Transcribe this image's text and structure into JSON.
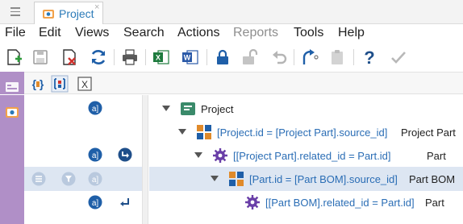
{
  "tab": {
    "label": "Project",
    "close": "×"
  },
  "menu": [
    "File",
    "Edit",
    "Views",
    "Search",
    "Actions",
    "Reports",
    "Tools",
    "Help"
  ],
  "menu_disabled": [
    "Reports"
  ],
  "toolbar": {
    "icons": [
      "new-icon",
      "save-icon",
      "delete-icon",
      "refresh-icon",
      "print-icon",
      "excel-icon",
      "word-icon",
      "lock-icon",
      "unlock-icon",
      "undo-icon",
      "promote-icon",
      "paste-icon",
      "help-icon",
      "done-icon"
    ]
  },
  "toolbar2": {
    "icons": [
      "form-icon",
      "braces-icon",
      "relationship-icon",
      "xml-icon"
    ]
  },
  "tree": {
    "root": {
      "label": "Project"
    },
    "nodes": [
      {
        "condition": "[Project.id = [Project Part].source_id]",
        "name": "Project Part",
        "type": "relationship"
      },
      {
        "condition": "[[Project Part].related_id = Part.id]",
        "name": "Part",
        "type": "item"
      },
      {
        "condition": "[Part.id = [Part BOM].source_id]",
        "name": "Part BOM",
        "type": "relationship"
      },
      {
        "condition": "[[Part BOM].related_id = Part.id]",
        "name": "Part",
        "type": "item"
      }
    ]
  },
  "colors": {
    "accent": "#2a7ab8",
    "strip": "#b08fc7",
    "highlight": "#dde6f2",
    "condition": "#2a6db5"
  }
}
